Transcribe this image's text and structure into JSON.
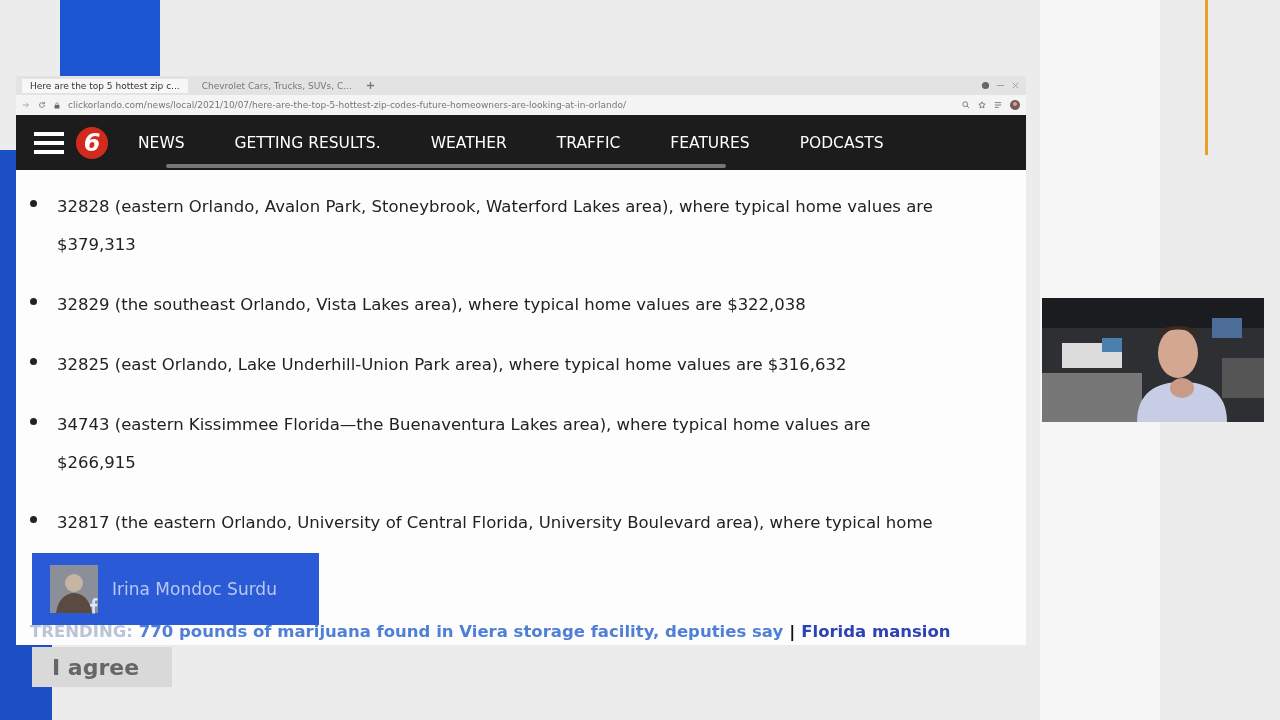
{
  "browser": {
    "tabs": [
      {
        "label": "Here are the top 5 hottest zip c...",
        "selected": true
      },
      {
        "label": "Chevrolet Cars, Trucks, SUVs, C...",
        "selected": false
      }
    ],
    "url": "clickorlando.com/news/local/2021/10/07/here-are-the-top-5-hottest-zip-codes-future-homeowners-are-looking-at-in-orlando/"
  },
  "site": {
    "logo": "6",
    "nav": [
      {
        "label": "NEWS"
      },
      {
        "label": "GETTING RESULTS."
      },
      {
        "label": "WEATHER"
      },
      {
        "label": "TRAFFIC"
      },
      {
        "label": "FEATURES"
      },
      {
        "label": "PODCASTS"
      }
    ]
  },
  "article": {
    "items": [
      "32828 (eastern Orlando, Avalon Park, Stoneybrook, Waterford Lakes area), where typical home values are $379,313",
      "32829 (the southeast Orlando, Vista Lakes area), where typical home values are $322,038",
      "32825 (east Orlando, Lake Underhill-Union Park area), where typical home values are $316,632",
      "34743 (eastern Kissimmee Florida—the Buenaventura Lakes area), where typical home values are $266,915",
      "32817 (the eastern Orlando, University of Central Florida, University Boulevard area), where typical home"
    ],
    "trending": {
      "label": "TRENDING:",
      "links": [
        "770 pounds of marijuana found in Viera storage facility, deputies say",
        "Florida mansion"
      ],
      "separator": "|"
    }
  },
  "comment_banner": {
    "name": "Irina Mondoc Surdu"
  },
  "agree_button": "I agree"
}
